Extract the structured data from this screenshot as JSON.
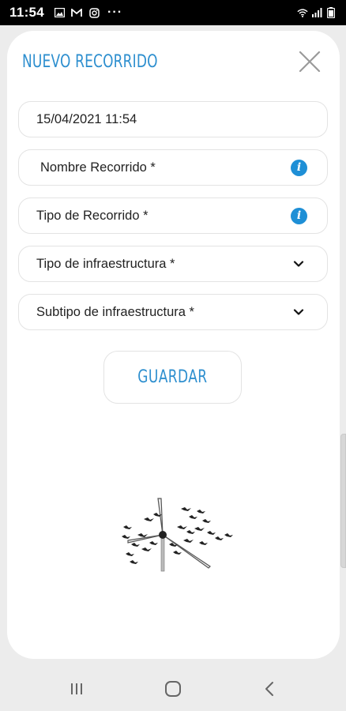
{
  "status_bar": {
    "time": "11:54",
    "left_icons": [
      "image-icon",
      "gmail-icon",
      "instagram-icon"
    ],
    "more": "···",
    "right_icons": [
      "wifi-icon",
      "signal-icon",
      "battery-icon"
    ]
  },
  "modal": {
    "title": "NUEVO RECORRIDO",
    "close_icon": "close-icon"
  },
  "form": {
    "date_value": "15/04/2021 11:54",
    "route_name_placeholder": "Nombre Recorrido *",
    "route_type_placeholder": "Tipo de Recorrido *",
    "infra_type_label": "Tipo de infraestructura *",
    "infra_subtype_label": "Subtipo de infraestructura *",
    "info_glyph": "i",
    "save_label": "GUARDAR"
  },
  "nav_bar": {
    "recents_icon": "recents-icon",
    "home_icon": "home-icon",
    "back_icon": "back-icon"
  },
  "colors": {
    "accent": "#2e8fcf",
    "info": "#1e8fd6",
    "background": "#ececec",
    "card": "#ffffff"
  }
}
